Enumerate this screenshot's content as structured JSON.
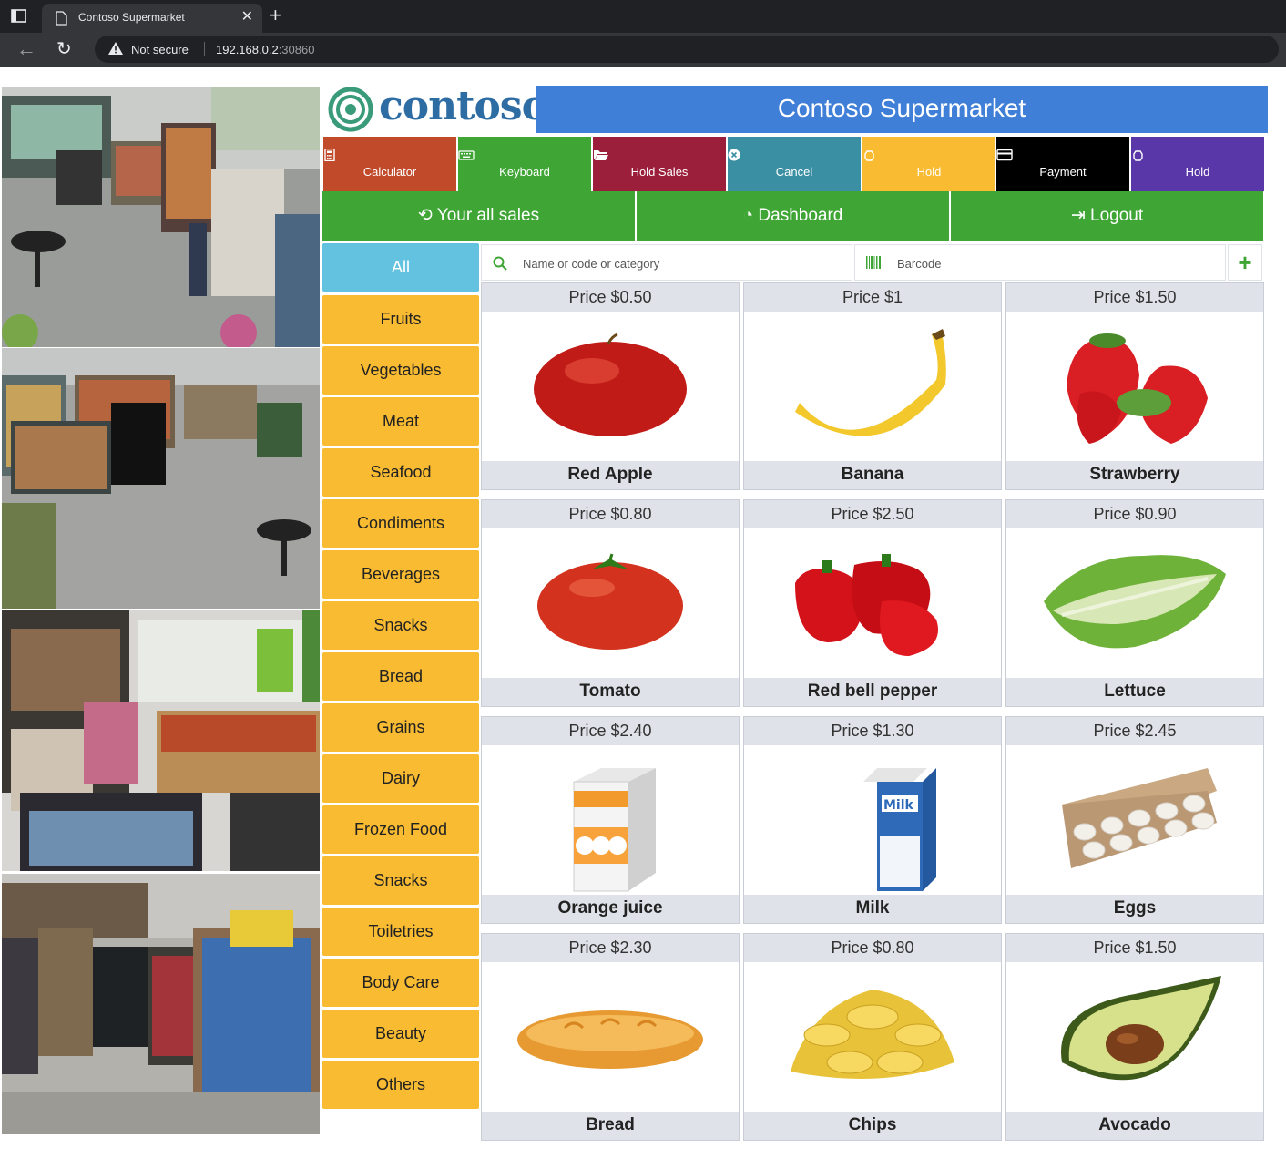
{
  "browser": {
    "tab_title": "Contoso Supermarket",
    "security_label": "Not secure",
    "url_host": "192.168.0.2",
    "url_port": ":30860"
  },
  "header": {
    "logo_text": "contoso",
    "store_title": "Contoso Supermarket"
  },
  "actions": [
    {
      "label": "Calculator",
      "icon": "calculator-icon",
      "color": "#c04a2a"
    },
    {
      "label": "Keyboard",
      "icon": "keyboard-icon",
      "color": "#3fa636"
    },
    {
      "label": "Hold Sales",
      "icon": "folder-open-icon",
      "color": "#9b1e3a"
    },
    {
      "label": "Cancel",
      "icon": "times-circle-icon",
      "color": "#3a8fa3"
    },
    {
      "label": "Hold",
      "icon": "hand-icon",
      "color": "#f8bb31"
    },
    {
      "label": "Payment",
      "icon": "credit-card-icon",
      "color": "#000000"
    },
    {
      "label": "Hold",
      "icon": "hand-icon",
      "color": "#5a37a8"
    }
  ],
  "nav": {
    "sales": "Your all sales",
    "dashboard": "Dashboard",
    "logout": "Logout"
  },
  "categories": [
    "All",
    "Fruits",
    "Vegetables",
    "Meat",
    "Seafood",
    "Condiments",
    "Beverages",
    "Snacks",
    "Bread",
    "Grains",
    "Dairy",
    "Frozen Food",
    "Snacks",
    "Toiletries",
    "Body Care",
    "Beauty",
    "Others"
  ],
  "search": {
    "placeholder": "Name or code or category",
    "barcode_placeholder": "Barcode",
    "add_label": "+"
  },
  "products": [
    {
      "price": "Price $0.50",
      "name": "Red Apple",
      "image": "apple"
    },
    {
      "price": "Price $1",
      "name": "Banana",
      "image": "banana"
    },
    {
      "price": "Price $1.50",
      "name": "Strawberry",
      "image": "strawberry"
    },
    {
      "price": "Price $0.80",
      "name": "Tomato",
      "image": "tomato"
    },
    {
      "price": "Price $2.50",
      "name": "Red bell pepper",
      "image": "pepper"
    },
    {
      "price": "Price $0.90",
      "name": "Lettuce",
      "image": "lettuce"
    },
    {
      "price": "Price $2.40",
      "name": "Orange juice",
      "image": "orange-juice"
    },
    {
      "price": "Price $1.30",
      "name": "Milk",
      "image": "milk"
    },
    {
      "price": "Price $2.45",
      "name": "Eggs",
      "image": "eggs"
    },
    {
      "price": "Price $2.30",
      "name": "Bread",
      "image": "bread"
    },
    {
      "price": "Price $0.80",
      "name": "Chips",
      "image": "chips"
    },
    {
      "price": "Price $1.50",
      "name": "Avocado",
      "image": "avocado"
    }
  ]
}
